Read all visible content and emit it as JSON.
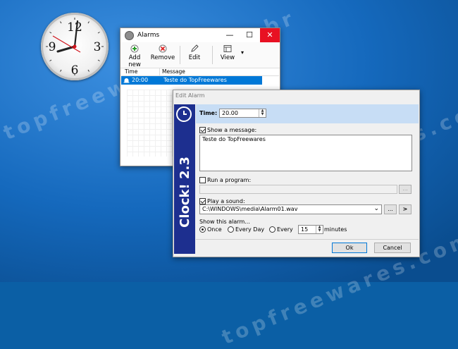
{
  "watermark": {
    "text": "topfreewares.com.br"
  },
  "clock": {
    "numerals": [
      "12",
      "3",
      "6",
      "9"
    ]
  },
  "alarms_window": {
    "title": "Alarms",
    "controls": {
      "minimize": "—",
      "maximize": "☐",
      "close": "✕"
    },
    "toolbar": {
      "add_new": "Add new",
      "remove": "Remove",
      "edit": "Edit",
      "view": "View",
      "view_arrow": "▾"
    },
    "list": {
      "columns": [
        "Time",
        "Message"
      ],
      "rows": [
        {
          "time": "20:00",
          "message": "Teste do TopFreewares"
        }
      ]
    }
  },
  "edit_alarm": {
    "title": "Edit Alarm",
    "brand": "Clock! 2.3",
    "time_label": "Time:",
    "time_value": "20.00",
    "show_message_label": "Show a message:",
    "message_text": "Teste do TopFreewares",
    "run_program_label": "Run a program:",
    "program_value": "",
    "browse_label": "...",
    "play_sound_label": "Play a sound:",
    "sound_value": "C:\\WINDOWS\\media\\Alarm01.wav",
    "play_label": ">",
    "dropdown_arrow": "⌄",
    "show_alarm_label": "Show this alarm...",
    "once_label": "Once",
    "every_day_label": "Every Day",
    "every_label": "Every",
    "every_value": "15",
    "minutes_label": "minutes",
    "ok_label": "Ok",
    "cancel_label": "Cancel",
    "spin_up": "▲",
    "spin_down": "▼",
    "checks": {
      "show_message": true,
      "run_program": false,
      "play_sound": true
    },
    "repeat_selected": "once"
  },
  "colors": {
    "desktop": "#0b5fa5",
    "selection": "#0078d7",
    "brand_panel": "#1d2f8f",
    "time_band": "#c7ddf5",
    "close_button": "#e81123"
  }
}
